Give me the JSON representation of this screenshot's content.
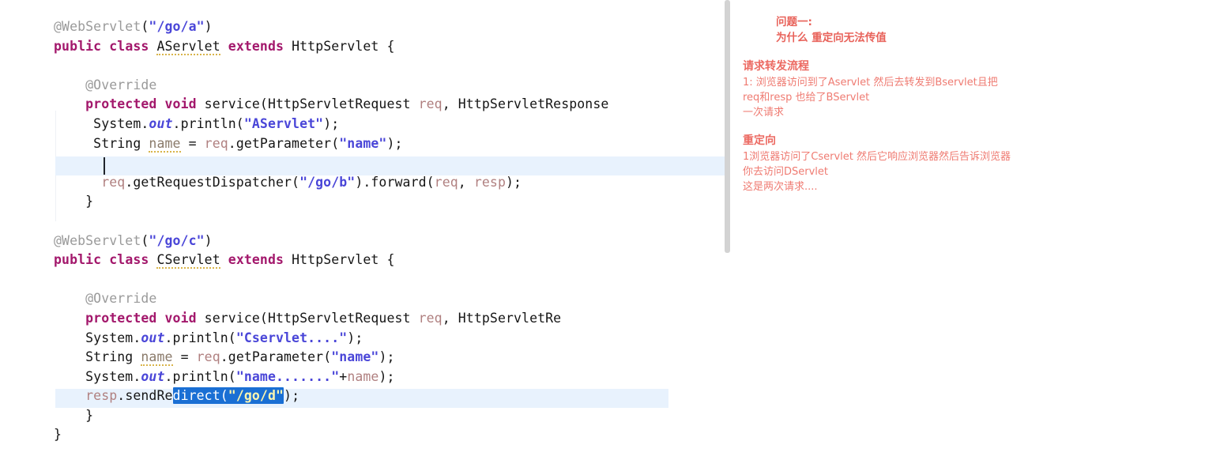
{
  "editor": {
    "name": "java-code-editor",
    "language": "Java",
    "caret_line_text": "",
    "selection_text": "direct(\"/go/d\"",
    "lines": [
      {
        "id": "l1",
        "indent": 0,
        "tokens": [
          {
            "t": "annotation",
            "v": "@WebServlet"
          },
          {
            "t": "plain",
            "v": "("
          },
          {
            "t": "string",
            "v": "\"/go/a\""
          },
          {
            "t": "plain",
            "v": ")"
          }
        ]
      },
      {
        "id": "l2",
        "indent": 0,
        "tokens": [
          {
            "t": "keyword",
            "v": "public"
          },
          {
            "t": "plain",
            "v": " "
          },
          {
            "t": "keyword",
            "v": "class"
          },
          {
            "t": "plain",
            "v": " "
          },
          {
            "t": "class-underline",
            "v": "AServlet"
          },
          {
            "t": "plain",
            "v": " "
          },
          {
            "t": "keyword",
            "v": "extends"
          },
          {
            "t": "plain",
            "v": " "
          },
          {
            "t": "plain",
            "v": "HttpServlet {"
          }
        ]
      },
      {
        "id": "l3",
        "indent": 0,
        "tokens": []
      },
      {
        "id": "l4",
        "indent": 1,
        "tokens": [
          {
            "t": "annotation",
            "v": "@Override"
          }
        ]
      },
      {
        "id": "l5",
        "indent": 1,
        "tokens": [
          {
            "t": "keyword",
            "v": "protected"
          },
          {
            "t": "plain",
            "v": " "
          },
          {
            "t": "keyword",
            "v": "void"
          },
          {
            "t": "plain",
            "v": " service(HttpServletRequest "
          },
          {
            "t": "param",
            "v": "req"
          },
          {
            "t": "plain",
            "v": ", HttpServletResponse"
          }
        ]
      },
      {
        "id": "l6",
        "indent": 1,
        "tokens": [
          {
            "t": "plain",
            "v": " System."
          },
          {
            "t": "field",
            "v": "out"
          },
          {
            "t": "plain",
            "v": ".println("
          },
          {
            "t": "string",
            "v": "\"AServlet\""
          },
          {
            "t": "plain",
            "v": ");"
          }
        ]
      },
      {
        "id": "l7",
        "indent": 1,
        "tokens": [
          {
            "t": "plain",
            "v": " String "
          },
          {
            "t": "var-underline",
            "v": "name"
          },
          {
            "t": "plain",
            "v": " = "
          },
          {
            "t": "param",
            "v": "req"
          },
          {
            "t": "plain",
            "v": ".getParameter("
          },
          {
            "t": "string",
            "v": "\"name\""
          },
          {
            "t": "plain",
            "v": ");"
          }
        ]
      },
      {
        "id": "l8",
        "indent": 1,
        "tokens": []
      },
      {
        "id": "l9",
        "indent": 1,
        "tokens": [
          {
            "t": "plain",
            "v": "  "
          },
          {
            "t": "param",
            "v": "req"
          },
          {
            "t": "plain",
            "v": ".getRequestDispatcher("
          },
          {
            "t": "string",
            "v": "\"/go/b\""
          },
          {
            "t": "plain",
            "v": ").forward("
          },
          {
            "t": "param",
            "v": "req"
          },
          {
            "t": "plain",
            "v": ", "
          },
          {
            "t": "param",
            "v": "resp"
          },
          {
            "t": "plain",
            "v": ");"
          }
        ]
      },
      {
        "id": "l10",
        "indent": 1,
        "tokens": [
          {
            "t": "plain",
            "v": "}"
          }
        ]
      },
      {
        "id": "l11",
        "indent": 0,
        "tokens": []
      },
      {
        "id": "l12",
        "indent": 0,
        "tokens": [
          {
            "t": "annotation",
            "v": "@WebServlet"
          },
          {
            "t": "plain",
            "v": "("
          },
          {
            "t": "string",
            "v": "\"/go/c\""
          },
          {
            "t": "plain",
            "v": ")"
          }
        ]
      },
      {
        "id": "l13",
        "indent": 0,
        "tokens": [
          {
            "t": "keyword",
            "v": "public"
          },
          {
            "t": "plain",
            "v": " "
          },
          {
            "t": "keyword",
            "v": "class"
          },
          {
            "t": "plain",
            "v": " "
          },
          {
            "t": "class-underline",
            "v": "CServlet"
          },
          {
            "t": "plain",
            "v": " "
          },
          {
            "t": "keyword",
            "v": "extends"
          },
          {
            "t": "plain",
            "v": " "
          },
          {
            "t": "plain",
            "v": "HttpServlet {"
          }
        ]
      },
      {
        "id": "l14",
        "indent": 0,
        "tokens": []
      },
      {
        "id": "l15",
        "indent": 1,
        "tokens": [
          {
            "t": "annotation",
            "v": "@Override"
          }
        ]
      },
      {
        "id": "l16",
        "indent": 1,
        "tokens": [
          {
            "t": "keyword",
            "v": "protected"
          },
          {
            "t": "plain",
            "v": " "
          },
          {
            "t": "keyword",
            "v": "void"
          },
          {
            "t": "plain",
            "v": " service(HttpServletRequest "
          },
          {
            "t": "param",
            "v": "req"
          },
          {
            "t": "plain",
            "v": ", HttpServletRe"
          }
        ]
      },
      {
        "id": "l17",
        "indent": 1,
        "tokens": [
          {
            "t": "plain",
            "v": "System."
          },
          {
            "t": "field",
            "v": "out"
          },
          {
            "t": "plain",
            "v": ".println("
          },
          {
            "t": "string",
            "v": "\"Cservlet....\""
          },
          {
            "t": "plain",
            "v": ");"
          }
        ]
      },
      {
        "id": "l18",
        "indent": 1,
        "tokens": [
          {
            "t": "plain",
            "v": "String "
          },
          {
            "t": "var-underline",
            "v": "name"
          },
          {
            "t": "plain",
            "v": " = "
          },
          {
            "t": "param",
            "v": "req"
          },
          {
            "t": "plain",
            "v": ".getParameter("
          },
          {
            "t": "string",
            "v": "\"name\""
          },
          {
            "t": "plain",
            "v": ");"
          }
        ]
      },
      {
        "id": "l19",
        "indent": 1,
        "tokens": [
          {
            "t": "plain",
            "v": "System."
          },
          {
            "t": "field",
            "v": "out"
          },
          {
            "t": "plain",
            "v": ".println("
          },
          {
            "t": "string",
            "v": "\"name.......\""
          },
          {
            "t": "plain",
            "v": "+"
          },
          {
            "t": "param",
            "v": "name"
          },
          {
            "t": "plain",
            "v": ");"
          }
        ]
      },
      {
        "id": "l20",
        "indent": 1,
        "tokens": [
          {
            "t": "param",
            "v": "resp"
          },
          {
            "t": "plain",
            "v": ".sendRe"
          },
          {
            "t": "selection",
            "v": "direct("
          },
          {
            "t": "selection-string",
            "v": "\"/go/d\""
          },
          {
            "t": "plain",
            "v": ");"
          }
        ]
      },
      {
        "id": "l21",
        "indent": 1,
        "tokens": [
          {
            "t": "plain",
            "v": "}"
          }
        ]
      },
      {
        "id": "l22",
        "indent": 0,
        "tokens": [
          {
            "t": "plain",
            "v": "}"
          }
        ]
      }
    ]
  },
  "notes": {
    "name": "annotation-notes-panel",
    "color": "#ef7b72",
    "blocks": [
      {
        "id": "q1",
        "indented": true,
        "lines": [
          {
            "text": "问题一:",
            "style": "title"
          },
          {
            "text": "为什么 重定向无法传值",
            "style": "title"
          }
        ]
      },
      {
        "id": "forward-flow",
        "indented": false,
        "lines": [
          {
            "text": "请求转发流程",
            "style": "head"
          },
          {
            "text": "1: 浏览器访问到了Aservlet 然后去转发到Bservlet且把",
            "style": "body"
          },
          {
            "text": "req和resp 也给了BServlet",
            "style": "body"
          },
          {
            "text": "一次请求",
            "style": "body"
          }
        ]
      },
      {
        "id": "redirect-flow",
        "indented": false,
        "lines": [
          {
            "text": "重定向",
            "style": "head"
          },
          {
            "text": "1浏览器访问了Cservlet 然后它响应浏览器然后告诉浏览器",
            "style": "body"
          },
          {
            "text": "你去访问DServlet",
            "style": "body"
          },
          {
            "text": "这是两次请求....",
            "style": "body"
          }
        ]
      }
    ]
  }
}
